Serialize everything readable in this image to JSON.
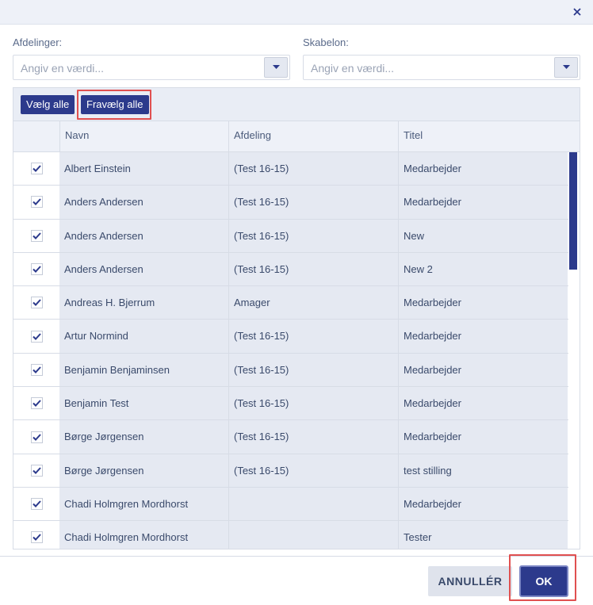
{
  "dialog": {
    "close_icon": "close-icon"
  },
  "filters": {
    "departments_label": "Afdelinger:",
    "departments_placeholder": "Angiv en værdi...",
    "template_label": "Skabelon:",
    "template_placeholder": "Angiv en værdi..."
  },
  "toolbar": {
    "select_all": "Vælg alle",
    "deselect_all": "Fravælg alle"
  },
  "grid": {
    "columns": [
      "Navn",
      "Afdeling",
      "Titel"
    ],
    "rows": [
      {
        "navn": "Albert Einstein",
        "afdeling": "(Test 16-15)",
        "titel": "Medarbejder",
        "checked": true
      },
      {
        "navn": "Anders Andersen",
        "afdeling": "(Test 16-15)",
        "titel": "Medarbejder",
        "checked": true
      },
      {
        "navn": "Anders Andersen",
        "afdeling": "(Test 16-15)",
        "titel": "New",
        "checked": true
      },
      {
        "navn": "Anders Andersen",
        "afdeling": "(Test 16-15)",
        "titel": "New 2",
        "checked": true
      },
      {
        "navn": "Andreas H. Bjerrum",
        "afdeling": "Amager",
        "titel": "Medarbejder",
        "checked": true
      },
      {
        "navn": "Artur Normind",
        "afdeling": "(Test 16-15)",
        "titel": "Medarbejder",
        "checked": true
      },
      {
        "navn": "Benjamin Benjaminsen",
        "afdeling": "(Test 16-15)",
        "titel": "Medarbejder",
        "checked": true
      },
      {
        "navn": "Benjamin Test",
        "afdeling": "(Test 16-15)",
        "titel": "Medarbejder",
        "checked": true
      },
      {
        "navn": "Børge Jørgensen",
        "afdeling": "(Test 16-15)",
        "titel": "Medarbejder",
        "checked": true
      },
      {
        "navn": "Børge Jørgensen",
        "afdeling": "(Test 16-15)",
        "titel": "test stilling",
        "checked": true
      },
      {
        "navn": "Chadi Holmgren Mordhorst",
        "afdeling": "",
        "titel": "Medarbejder",
        "checked": true
      },
      {
        "navn": "Chadi Holmgren Mordhorst",
        "afdeling": "",
        "titel": "Tester",
        "checked": true
      }
    ]
  },
  "footer": {
    "cancel_label": "ANNULLÉR",
    "ok_label": "OK"
  },
  "colors": {
    "accent": "#2c3a8c",
    "highlight": "#e05050",
    "row_bg": "#e5e9f2"
  }
}
